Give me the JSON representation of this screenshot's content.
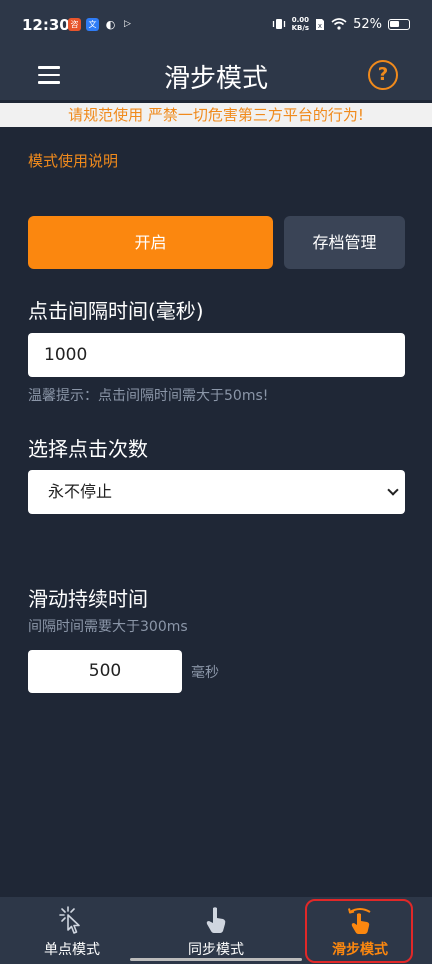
{
  "status_bar": {
    "time": "12:30",
    "net_speed_top": "0.00",
    "net_speed_bottom": "KB/s",
    "battery": "52%",
    "notif_icons": [
      {
        "name": "app-notification-icon-1",
        "glyph": "咨",
        "color": "#e8552c"
      },
      {
        "name": "app-notification-icon-2",
        "glyph": "文",
        "color": "#2f7cf6"
      },
      {
        "name": "app-notification-icon-3",
        "glyph": "◐",
        "color": "#ffffff"
      },
      {
        "name": "app-notification-icon-4",
        "glyph": "▷",
        "color": "#ffffff"
      }
    ]
  },
  "app_bar": {
    "title": "滑步模式",
    "help_glyph": "?"
  },
  "warning_banner": "请规范使用 严禁一切危害第三方平台的行为!",
  "instructions_link": "模式使用说明",
  "buttons": {
    "start": "开启",
    "archive": "存档管理"
  },
  "click_interval": {
    "label": "点击间隔时间(毫秒)",
    "value": "1000",
    "hint": "温馨提示：点击间隔时间需大于50ms!"
  },
  "click_count": {
    "label": "选择点击次数",
    "selected": "永不停止"
  },
  "slide_duration": {
    "label": "滑动持续时间",
    "hint": "间隔时间需要大于300ms",
    "value": "500",
    "unit": "毫秒"
  },
  "bottom_nav": {
    "items": [
      {
        "label": "单点模式",
        "icon": "tap-sparkle-icon",
        "active": false
      },
      {
        "label": "同步模式",
        "icon": "hand-pointer-icon",
        "active": false
      },
      {
        "label": "滑步模式",
        "icon": "swipe-hand-icon",
        "active": true
      }
    ]
  },
  "colors": {
    "accent": "#fb870f",
    "background": "#1f2736",
    "bar": "#2d3748",
    "highlight_ring": "#e12828"
  }
}
